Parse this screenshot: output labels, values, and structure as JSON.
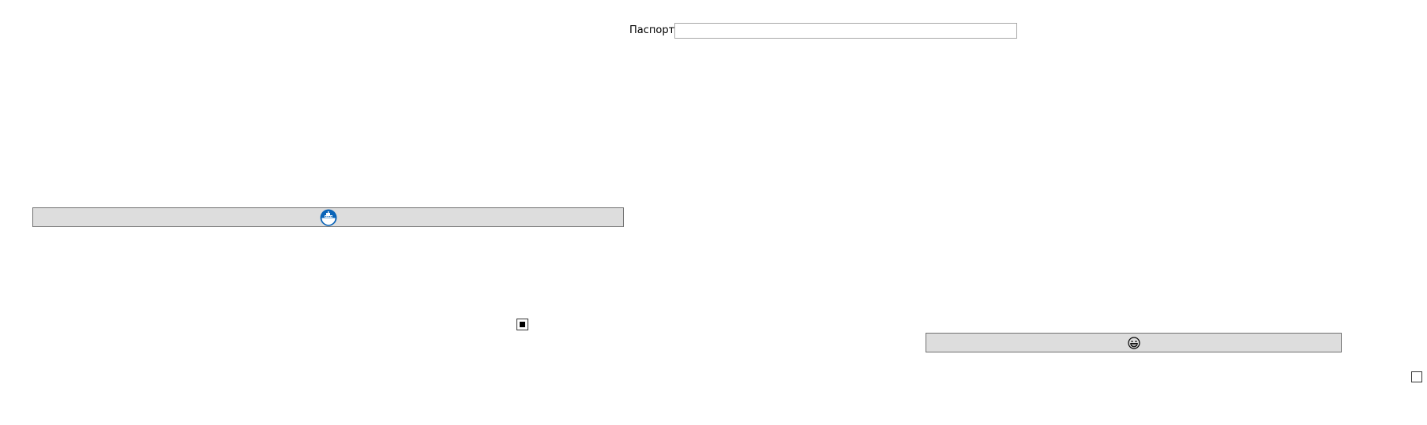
{
  "passport_field": {
    "label": "Паспорт",
    "value": "",
    "placeholder": ""
  },
  "buttons": [
    {
      "icon": "ship-badge-icon",
      "label": "",
      "icon_color": "#0a64b8"
    },
    {
      "icon": "grinning-face-icon",
      "label": "",
      "icon_color": "#000000"
    }
  ],
  "checkboxes": [
    {
      "checked": true
    },
    {
      "checked": false
    }
  ],
  "colors": {
    "button_background": "#dddddd",
    "button_border": "#707070",
    "input_border": "#a8a8a8",
    "page_background": "#ffffff"
  }
}
